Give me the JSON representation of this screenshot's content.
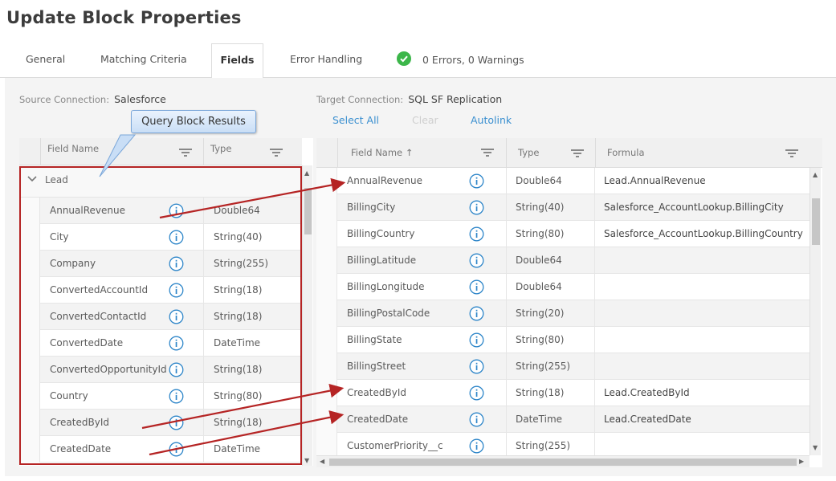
{
  "page_title": "Update Block Properties",
  "tabs": [
    {
      "label": "General"
    },
    {
      "label": "Matching Criteria"
    },
    {
      "label": "Fields",
      "active": true
    },
    {
      "label": "Error Handling"
    }
  ],
  "status": {
    "text": "0 Errors, 0 Warnings",
    "icon": "check-circle-icon",
    "color": "#3cb64a"
  },
  "source": {
    "label": "Source Connection:",
    "value": "Salesforce"
  },
  "target": {
    "label": "Target Connection:",
    "value": "SQL SF Replication"
  },
  "actions": {
    "select_all": "Select All",
    "clear": "Clear",
    "autolink": "Autolink"
  },
  "callout": {
    "text": "Query Block Results"
  },
  "left_grid": {
    "headers": {
      "field_name": "Field Name",
      "type": "Type"
    },
    "group": "Lead",
    "rows": [
      {
        "name": "AnnualRevenue",
        "type": "Double64"
      },
      {
        "name": "City",
        "type": "String(40)"
      },
      {
        "name": "Company",
        "type": "String(255)"
      },
      {
        "name": "ConvertedAccountId",
        "type": "String(18)"
      },
      {
        "name": "ConvertedContactId",
        "type": "String(18)"
      },
      {
        "name": "ConvertedDate",
        "type": "DateTime"
      },
      {
        "name": "ConvertedOpportunityId",
        "type": "String(18)"
      },
      {
        "name": "Country",
        "type": "String(80)"
      },
      {
        "name": "CreatedById",
        "type": "String(18)"
      },
      {
        "name": "CreatedDate",
        "type": "DateTime"
      }
    ]
  },
  "right_grid": {
    "headers": {
      "field_name": "Field Name ↑",
      "type": "Type",
      "formula": "Formula"
    },
    "rows": [
      {
        "name": "AnnualRevenue",
        "type": "Double64",
        "formula": "Lead.AnnualRevenue"
      },
      {
        "name": "BillingCity",
        "type": "String(40)",
        "formula": "Salesforce_AccountLookup.BillingCity"
      },
      {
        "name": "BillingCountry",
        "type": "String(80)",
        "formula": "Salesforce_AccountLookup.BillingCountry"
      },
      {
        "name": "BillingLatitude",
        "type": "Double64",
        "formula": ""
      },
      {
        "name": "BillingLongitude",
        "type": "Double64",
        "formula": ""
      },
      {
        "name": "BillingPostalCode",
        "type": "String(20)",
        "formula": ""
      },
      {
        "name": "BillingState",
        "type": "String(80)",
        "formula": ""
      },
      {
        "name": "BillingStreet",
        "type": "String(255)",
        "formula": ""
      },
      {
        "name": "CreatedById",
        "type": "String(18)",
        "formula": "Lead.CreatedById"
      },
      {
        "name": "CreatedDate",
        "type": "DateTime",
        "formula": "Lead.CreatedDate"
      },
      {
        "name": "CustomerPriority__c",
        "type": "String(255)",
        "formula": ""
      }
    ]
  },
  "colors": {
    "accent": "#3a8fd0",
    "annotation": "#b52424",
    "info_icon": "#2e86c9"
  }
}
